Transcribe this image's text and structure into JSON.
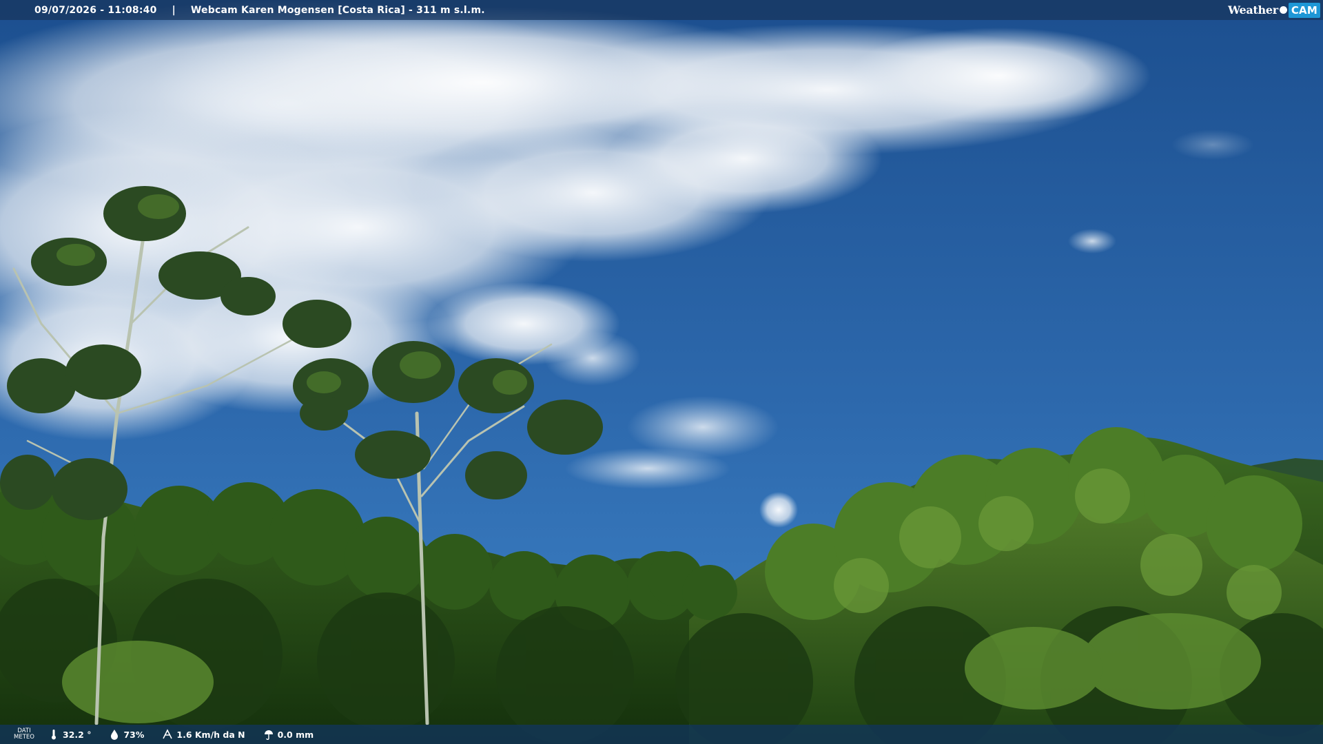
{
  "overlay_top": {
    "timestamp": "09/07/2026 - 11:08:40",
    "separator": "|",
    "title": "Webcam Karen Mogensen [Costa Rica] - 311 m s.l.m.",
    "brand_weather": "Weather",
    "brand_cam": "CAM"
  },
  "overlay_bottom": {
    "label_line1": "DATI",
    "label_line2": "METEO",
    "temperature": "32.2 °",
    "humidity": "73%",
    "wind": "1.6 Km/h da N",
    "rain": "0.0 mm",
    "icons": [
      "thermometer-icon",
      "humidity-drop-icon",
      "wind-icon",
      "rain-icon"
    ]
  },
  "colors": {
    "sky_top": "#1c4f8f",
    "sky_bottom": "#3b7fc6",
    "forest_dark": "#1c3a12",
    "forest_mid": "#3f6a22",
    "forest_light": "#6f9a3a"
  }
}
